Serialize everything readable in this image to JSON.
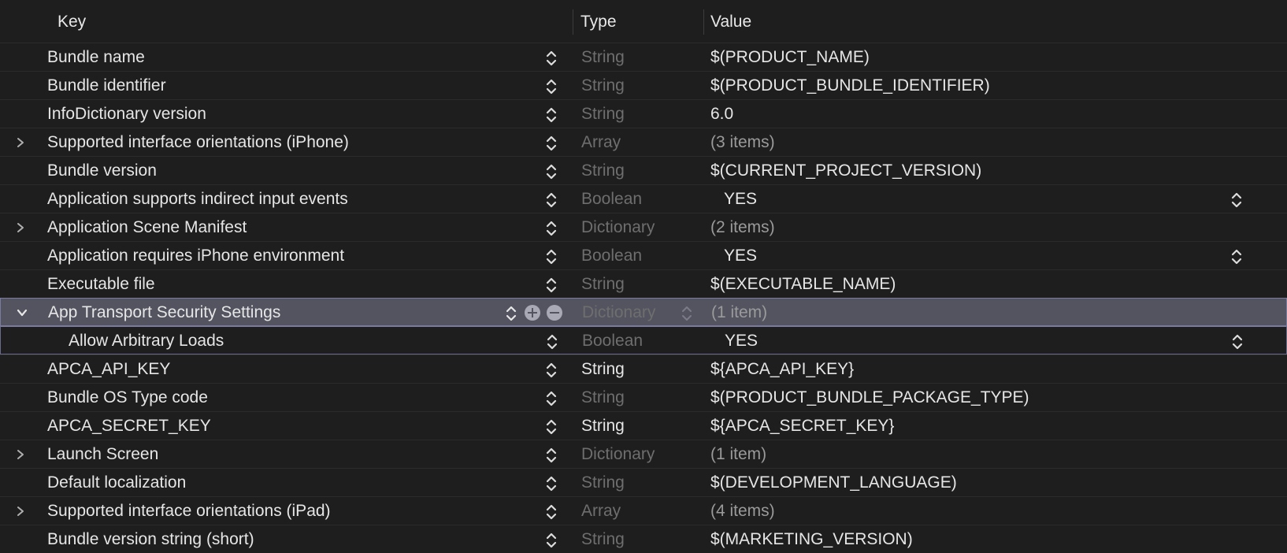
{
  "header": {
    "key_label": "Key",
    "type_label": "Type",
    "value_label": "Value"
  },
  "rows": [
    {
      "key": "Bundle name",
      "type": "String",
      "value": "$(PRODUCT_NAME)"
    },
    {
      "key": "Bundle identifier",
      "type": "String",
      "value": "$(PRODUCT_BUNDLE_IDENTIFIER)"
    },
    {
      "key": "InfoDictionary version",
      "type": "String",
      "value": "6.0"
    },
    {
      "key": "Supported interface orientations (iPhone)",
      "type": "Array",
      "value": "(3 items)"
    },
    {
      "key": "Bundle version",
      "type": "String",
      "value": "$(CURRENT_PROJECT_VERSION)"
    },
    {
      "key": "Application supports indirect input events",
      "type": "Boolean",
      "value": "YES"
    },
    {
      "key": "Application Scene Manifest",
      "type": "Dictionary",
      "value": "(2 items)"
    },
    {
      "key": "Application requires iPhone environment",
      "type": "Boolean",
      "value": "YES"
    },
    {
      "key": "Executable file",
      "type": "String",
      "value": "$(EXECUTABLE_NAME)"
    },
    {
      "key": "App Transport Security Settings",
      "type": "Dictionary",
      "value": "(1 item)"
    },
    {
      "key": "Allow Arbitrary Loads",
      "type": "Boolean",
      "value": "YES"
    },
    {
      "key": "APCA_API_KEY",
      "type": "String",
      "value": "${APCA_API_KEY}"
    },
    {
      "key": "Bundle OS Type code",
      "type": "String",
      "value": "$(PRODUCT_BUNDLE_PACKAGE_TYPE)"
    },
    {
      "key": "APCA_SECRET_KEY",
      "type": "String",
      "value": "${APCA_SECRET_KEY}"
    },
    {
      "key": "Launch Screen",
      "type": "Dictionary",
      "value": "(1 item)"
    },
    {
      "key": "Default localization",
      "type": "String",
      "value": "$(DEVELOPMENT_LANGUAGE)"
    },
    {
      "key": "Supported interface orientations (iPad)",
      "type": "Array",
      "value": "(4 items)"
    },
    {
      "key": "Bundle version string (short)",
      "type": "String",
      "value": "$(MARKETING_VERSION)"
    }
  ],
  "colors": {
    "background": "#1e1e1e",
    "selected_row": "#545461",
    "selection_border": "#7b7ba0",
    "text_primary": "#e6e6e6",
    "text_dim": "#6e6e6e"
  },
  "icons": {
    "disclosure_collapsed": "chevron-right-icon",
    "disclosure_expanded": "chevron-down-icon",
    "stepper": "up-down-stepper-icon",
    "add": "plus-circle-icon",
    "remove": "minus-circle-icon"
  }
}
